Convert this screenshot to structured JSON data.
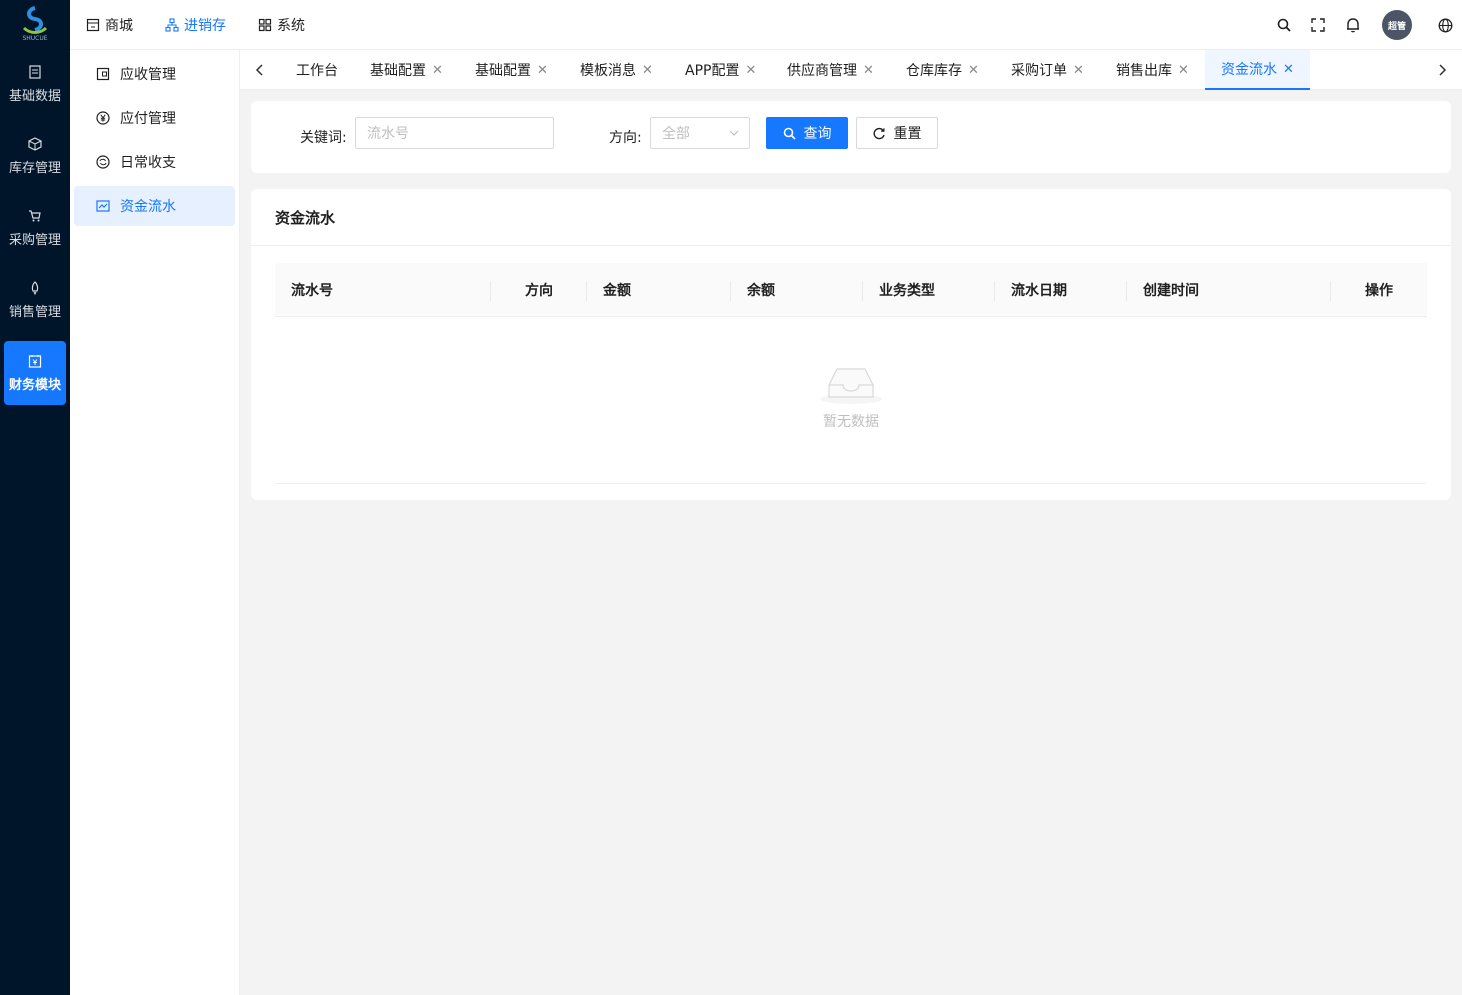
{
  "brand": {
    "logo_text": "SHUCUE"
  },
  "rail": {
    "items": [
      {
        "label": "基础数据"
      },
      {
        "label": "库存管理"
      },
      {
        "label": "采购管理"
      },
      {
        "label": "销售管理"
      },
      {
        "label": "财务模块"
      }
    ],
    "active_index": 4
  },
  "header": {
    "nav": [
      {
        "label": "商城"
      },
      {
        "label": "进销存"
      },
      {
        "label": "系统"
      }
    ],
    "active_nav": 1,
    "user": {
      "avatar_text": "超管"
    }
  },
  "sub_sidebar": {
    "items": [
      {
        "label": "应收管理"
      },
      {
        "label": "应付管理"
      },
      {
        "label": "日常收支"
      },
      {
        "label": "资金流水"
      }
    ],
    "active_index": 3
  },
  "tabs": {
    "items": [
      {
        "label": "工作台",
        "closable": false
      },
      {
        "label": "基础配置",
        "closable": true
      },
      {
        "label": "基础配置",
        "closable": true
      },
      {
        "label": "模板消息",
        "closable": true
      },
      {
        "label": "APP配置",
        "closable": true
      },
      {
        "label": "供应商管理",
        "closable": true
      },
      {
        "label": "仓库库存",
        "closable": true
      },
      {
        "label": "采购订单",
        "closable": true
      },
      {
        "label": "销售出库",
        "closable": true
      },
      {
        "label": "资金流水",
        "closable": true
      }
    ],
    "active_index": 9
  },
  "filter": {
    "keyword_label": "关键词:",
    "keyword_placeholder": "流水号",
    "keyword_value": "",
    "direction_label": "方向:",
    "direction_value": "全部",
    "search_button": "查询",
    "reset_button": "重置"
  },
  "table": {
    "title": "资金流水",
    "columns": [
      "流水号",
      "方向",
      "金额",
      "余额",
      "业务类型",
      "流水日期",
      "创建时间",
      "操作"
    ],
    "rows": [],
    "empty_text": "暂无数据"
  },
  "colors": {
    "primary": "#1677ff",
    "rail_bg": "#001529"
  }
}
